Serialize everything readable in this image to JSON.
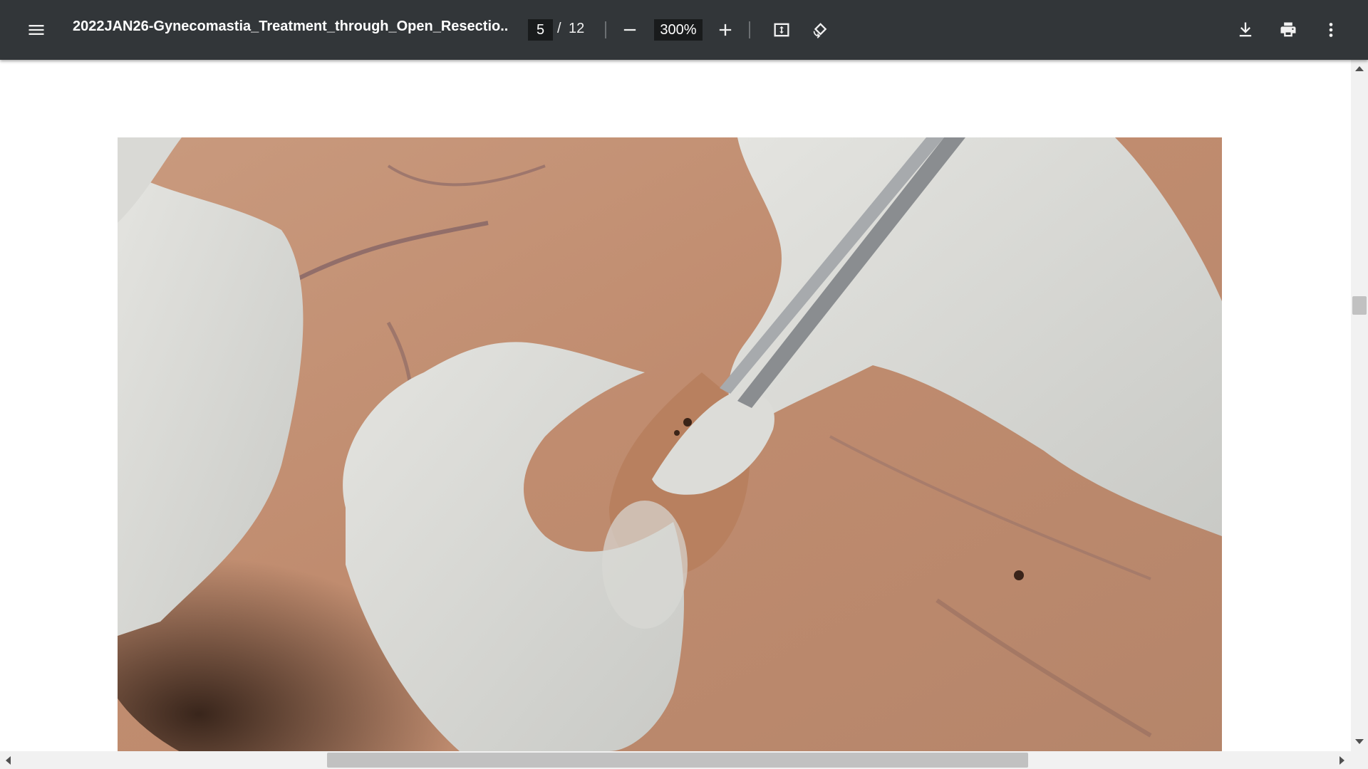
{
  "toolbar": {
    "title": "2022JAN26-Gynecomastia_Treatment_through_Open_Resectio...",
    "page_current": "5",
    "page_separator": "/",
    "page_total": "12",
    "zoom": "300%",
    "icons": {
      "menu": "menu-icon",
      "zoom_out": "minus-icon",
      "zoom_in": "plus-icon",
      "fit": "fit-to-page-icon",
      "rotate": "rotate-counterclockwise-icon",
      "download": "download-icon",
      "print": "print-icon",
      "more": "more-vertical-icon"
    }
  },
  "document": {
    "page_image": "surgical-photo"
  },
  "colors": {
    "toolbar_bg": "#323639",
    "page_bg": "#ffffff",
    "scrollbar_track": "#f1f1f1",
    "scrollbar_thumb": "#c1c1c1"
  }
}
